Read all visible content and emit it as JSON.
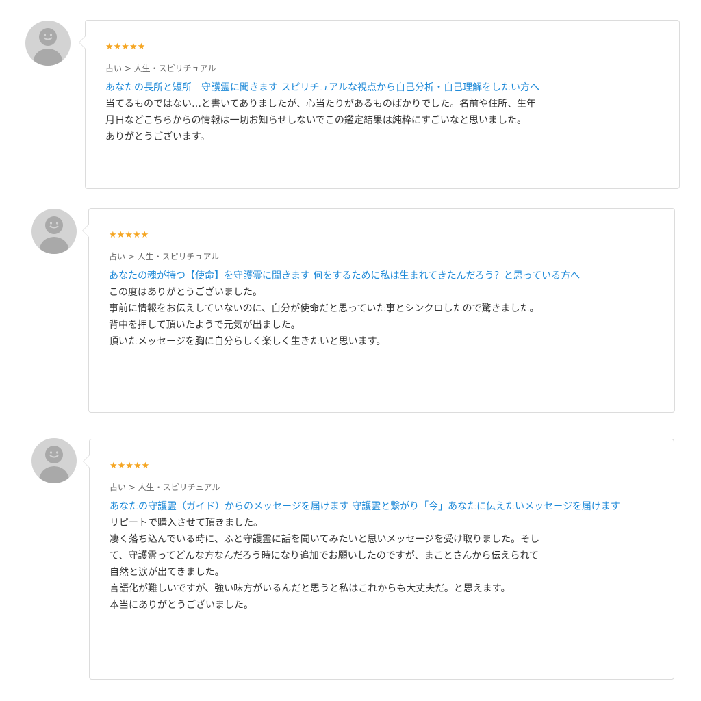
{
  "reviews": [
    {
      "stars": "★★★★★",
      "category": "占い > 人生・スピリチュアル",
      "service_title": "あなたの長所と短所　守護霊に聞きます スピリチュアルな視点から自己分析・自己理解をしたい方へ",
      "body": [
        "当てるものではない…と書いてありましたが、心当たりがあるものばかりでした。名前や住所、生年",
        "月日などこちらからの情報は一切お知らせしないでこの鑑定結果は純粋にすごいなと思いました。",
        "ありがとうございます。"
      ]
    },
    {
      "stars": "★★★★★",
      "category": "占い > 人生・スピリチュアル",
      "service_title": "あなたの魂が持つ【使命】を守護霊に聞きます 何をするために私は生まれてきたんだろう？と思っている方へ",
      "body": [
        "この度はありがとうございました。",
        "事前に情報をお伝えしていないのに、自分が使命だと思っていた事とシンクロしたので驚きました。",
        "背中を押して頂いたようで元気が出ました。",
        "頂いたメッセージを胸に自分らしく楽しく生きたいと思います。"
      ]
    },
    {
      "stars": "★★★★★",
      "category": "占い > 人生・スピリチュアル",
      "service_title": "あなたの守護霊（ガイド）からのメッセージを届けます 守護霊と繋がり「今」あなたに伝えたいメッセージを届けます",
      "body": [
        "リピートで購入させて頂きました。",
        "凄く落ち込んでいる時に、ふと守護霊に話を聞いてみたいと思いメッセージを受け取りました。そし",
        "て、守護霊ってどんな方なんだろう時になり追加でお願いしたのですが、まことさんから伝えられて",
        "自然と涙が出てきました。",
        "言語化が難しいですが、強い味方がいるんだと思うと私はこれからも大丈夫だ。と思えます。",
        "本当にありがとうございました。"
      ]
    }
  ],
  "colors": {
    "star": "#f5a623",
    "link": "#1f8ad8",
    "avatar": "#d3d3d3"
  },
  "icons": {
    "avatar": "default-user-avatar-icon",
    "star": "star-icon"
  }
}
